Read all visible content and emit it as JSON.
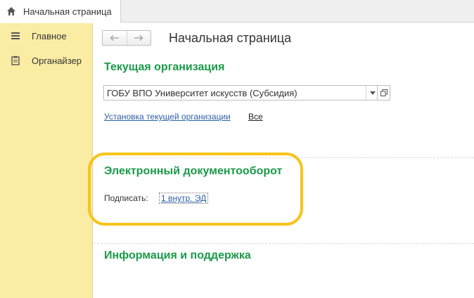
{
  "tabs": [
    {
      "label": "Начальная страница",
      "icon": "home-icon",
      "active": true
    }
  ],
  "sidebar": {
    "items": [
      {
        "label": "Главное",
        "icon": "menu-lines-icon"
      },
      {
        "label": "Органайзер",
        "icon": "clipboard-icon"
      }
    ]
  },
  "main": {
    "title": "Начальная страница",
    "org_section": {
      "title": "Текущая организация",
      "field_value": "ГОБУ ВПО Университет искусств (Субсидия)",
      "setup_link": "Установка текущей организации",
      "all_link": "Все"
    },
    "edo_section": {
      "title": "Электронный документооборот",
      "sign_label": "Подписать:",
      "sign_link": "1 внутр. ЭД"
    },
    "info_section": {
      "title": "Информация и поддержка"
    }
  },
  "colors": {
    "accent_green": "#1a9a49",
    "sidebar_bg": "#fbeca4",
    "highlight": "#f7c41c",
    "link": "#2d5fa8"
  }
}
